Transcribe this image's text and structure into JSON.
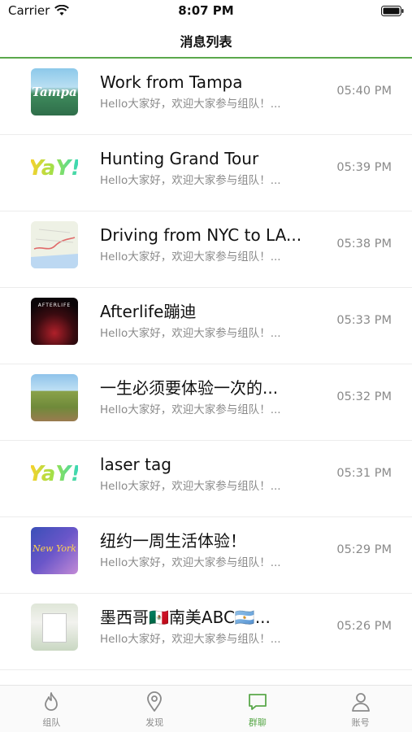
{
  "status_bar": {
    "carrier": "Carrier",
    "time": "8:07 PM"
  },
  "nav": {
    "title": "消息列表"
  },
  "messages": [
    {
      "title": "Work from Tampa",
      "preview": "Hello大家好，欢迎大家参与组队！...",
      "time": "05:40 PM",
      "thumb_text": "Tampa"
    },
    {
      "title": "Hunting Grand Tour",
      "preview": "Hello大家好，欢迎大家参与组队！...",
      "time": "05:39 PM",
      "thumb_text": "YaY!"
    },
    {
      "title": "Driving from NYC to LA...",
      "preview": "Hello大家好，欢迎大家参与组队！...",
      "time": "05:38 PM",
      "thumb_text": ""
    },
    {
      "title": "Afterlife蹦迪",
      "preview": "Hello大家好，欢迎大家参与组队！...",
      "time": "05:33 PM",
      "thumb_text": "AFTERLIFE"
    },
    {
      "title": "一生必须要体验一次的...",
      "preview": "Hello大家好，欢迎大家参与组队！...",
      "time": "05:32 PM",
      "thumb_text": ""
    },
    {
      "title": "laser tag",
      "preview": "Hello大家好，欢迎大家参与组队！...",
      "time": "05:31 PM",
      "thumb_text": "YaY!"
    },
    {
      "title": "纽约一周生活体验！",
      "preview": "Hello大家好，欢迎大家参与组队！...",
      "time": "05:29 PM",
      "thumb_text": "New York"
    },
    {
      "title": "墨西哥🇲🇽南美ABC🇦🇷...",
      "preview": "Hello大家好，欢迎大家参与组队！...",
      "time": "05:26 PM",
      "thumb_text": ""
    }
  ],
  "tabs": [
    {
      "label": "组队",
      "icon": "flame-icon",
      "active": false
    },
    {
      "label": "发现",
      "icon": "location-pin-icon",
      "active": false
    },
    {
      "label": "群聊",
      "icon": "chat-bubble-icon",
      "active": true
    },
    {
      "label": "账号",
      "icon": "person-icon",
      "active": false
    }
  ],
  "colors": {
    "accent": "#5aa84b",
    "secondary_text": "#8a8a8a"
  }
}
